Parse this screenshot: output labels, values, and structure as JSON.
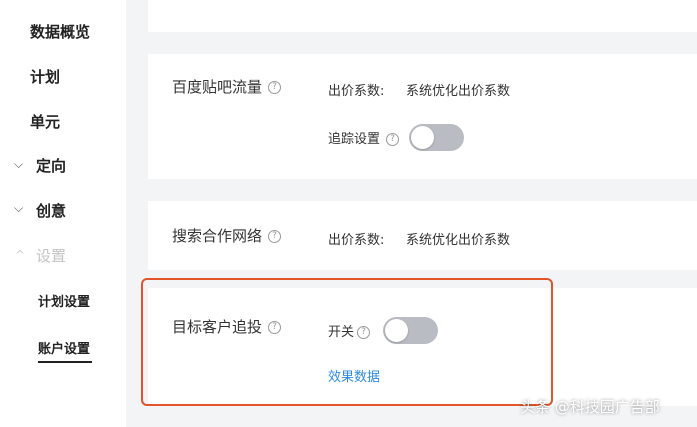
{
  "sidebar": {
    "items": [
      {
        "label": "数据概览"
      },
      {
        "label": "计划"
      },
      {
        "label": "单元"
      },
      {
        "label": "定向"
      },
      {
        "label": "创意"
      },
      {
        "label": "设置"
      }
    ],
    "sub_items": [
      {
        "label": "计划设置"
      },
      {
        "label": "账户设置"
      }
    ],
    "chevrons": {
      "down": "⌵",
      "up": "^"
    }
  },
  "cards": {
    "baidu_tieba": {
      "title": "百度贴吧流量",
      "bid_label": "出价系数:",
      "bid_value": "系统优化出价系数",
      "tracking_label": "追踪设置",
      "tracking_on": false
    },
    "search_network": {
      "title": "搜索合作网络",
      "bid_label": "出价系数:",
      "bid_value": "系统优化出价系数"
    },
    "target_tracking": {
      "title": "目标客户追投",
      "switch_label": "开关",
      "switch_on": false,
      "link": "效果数据"
    }
  },
  "help_glyph": "?",
  "watermark": "头条 @科技园广告部",
  "colors": {
    "accent_link": "#2f8be0",
    "highlight_border": "#e4542a",
    "toggle_off": "#b9bcc2",
    "page_bg": "#f3f4f6"
  }
}
